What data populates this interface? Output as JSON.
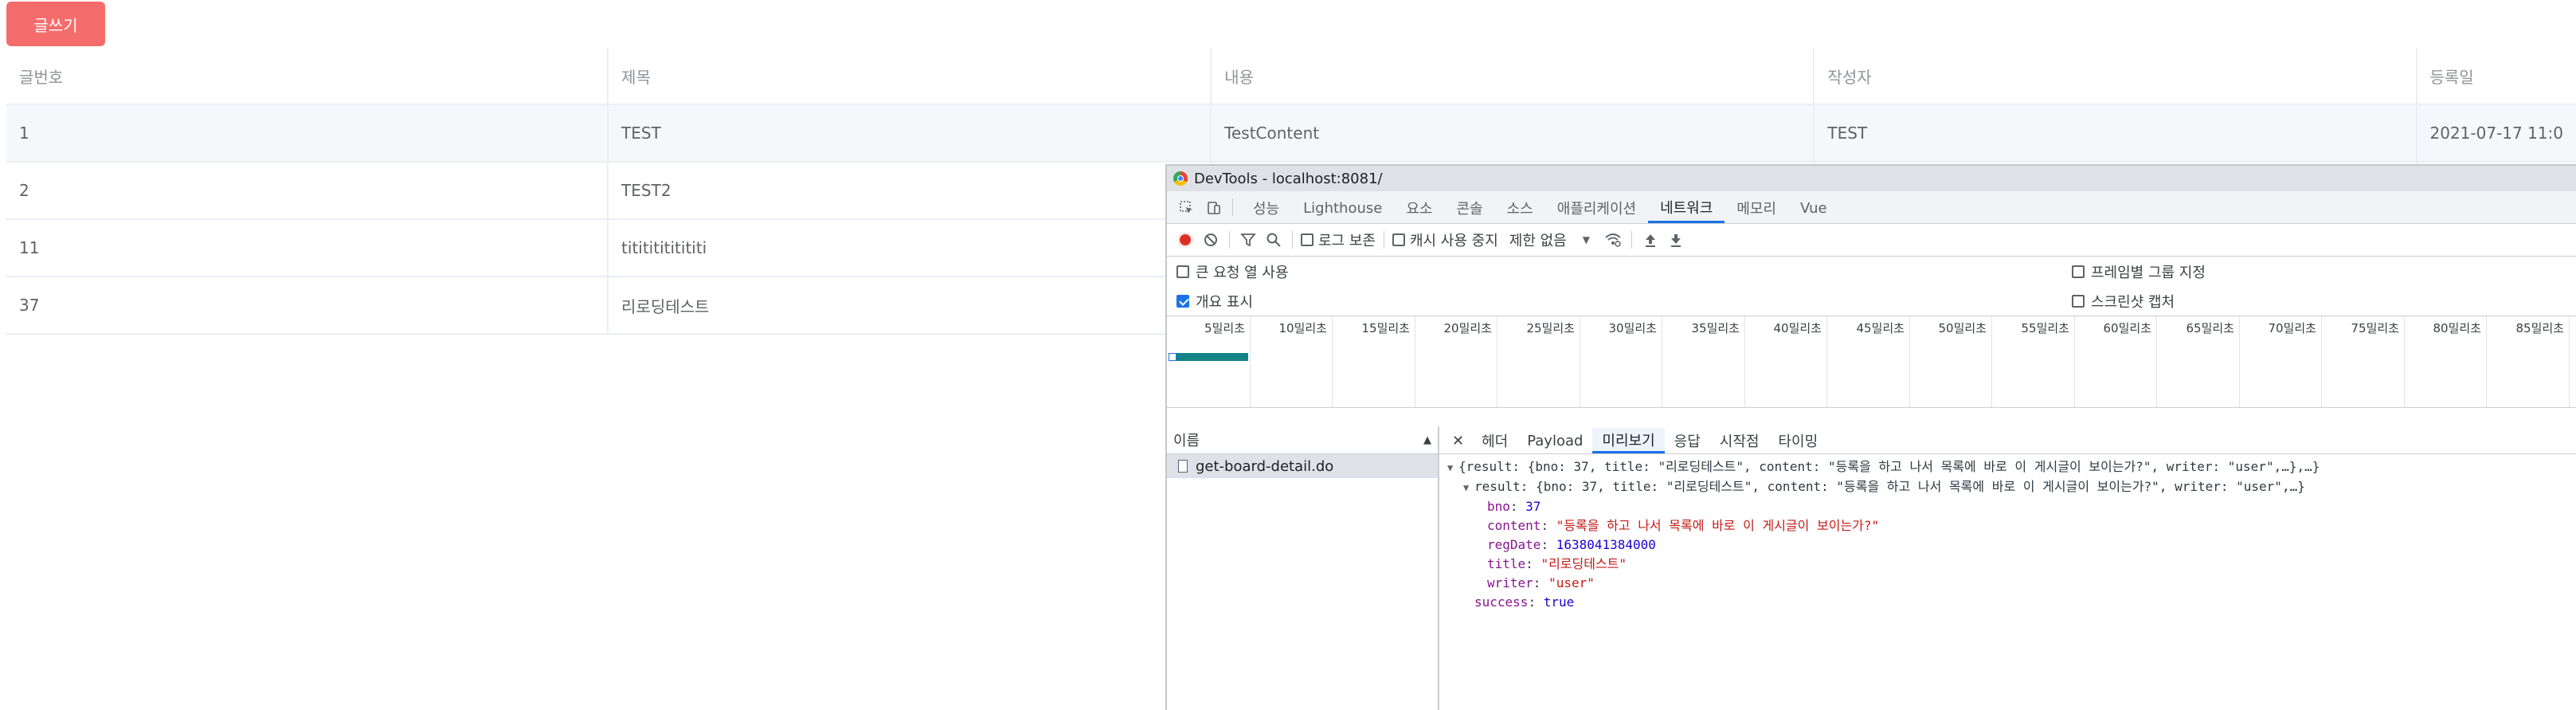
{
  "board": {
    "write_button": "글쓰기",
    "columns": [
      "글번호",
      "제목",
      "내용",
      "작성자",
      "등록일"
    ],
    "rows": [
      {
        "no": "1",
        "title": "TEST",
        "content": "TestContent",
        "writer": "TEST",
        "date": "2021-07-17 11:0"
      },
      {
        "no": "2",
        "title": "TEST2",
        "content": "",
        "writer": "",
        "date": ""
      },
      {
        "no": "11",
        "title": "titititititititi",
        "content": "",
        "writer": "",
        "date": ""
      },
      {
        "no": "37",
        "title": "리로딩테스트",
        "content": "",
        "writer": "",
        "date": ""
      }
    ]
  },
  "devtools": {
    "window_title": "DevTools - localhost:8081/",
    "tabs": [
      "성능",
      "Lighthouse",
      "요소",
      "콘솔",
      "소스",
      "애플리케이션",
      "네트워크",
      "메모리",
      "Vue"
    ],
    "active_tab": "네트워크",
    "toolbar": {
      "preserve_log": "로그 보존",
      "disable_cache": "캐시 사용 중지",
      "throttle": "제한 없음"
    },
    "options": {
      "large_rows": "큰 요청 열 사용",
      "show_overview": "개요 표시",
      "group_by_frame": "프레임별 그룹 지정",
      "screenshots": "스크린샷 캡처"
    },
    "timeline_labels": [
      "5밀리초",
      "10밀리초",
      "15밀리초",
      "20밀리초",
      "25밀리초",
      "30밀리초",
      "35밀리초",
      "40밀리초",
      "45밀리초",
      "50밀리초",
      "55밀리초",
      "60밀리초",
      "65밀리초",
      "70밀리초",
      "75밀리초",
      "80밀리초",
      "85밀리초"
    ],
    "name_header": "이름",
    "request_name": "get-board-detail.do",
    "detail_tabs": [
      "헤더",
      "Payload",
      "미리보기",
      "응답",
      "시작점",
      "타이밍"
    ],
    "active_detail_tab": "미리보기",
    "preview": {
      "summary_line": "{result: {bno: 37, title: \"리로딩테스트\", content: \"등록을 하고 나서 목록에 바로 이 게시글이 보이는가?\", writer: \"user\",…},…}",
      "result_line": "result: {bno: 37, title: \"리로딩테스트\", content: \"등록을 하고 나서 목록에 바로 이 게시글이 보이는가?\", writer: \"user\",…}",
      "bno_key": "bno",
      "bno_val": "37",
      "content_key": "content",
      "content_val": "\"등록을 하고 나서 목록에 바로 이 게시글이 보이는가?\"",
      "regdate_key": "regDate",
      "regdate_val": "1638041384000",
      "title_key": "title",
      "title_val": "\"리로딩테스트\"",
      "writer_key": "writer",
      "writer_val": "\"user\"",
      "success_key": "success",
      "success_val": "true"
    }
  }
}
